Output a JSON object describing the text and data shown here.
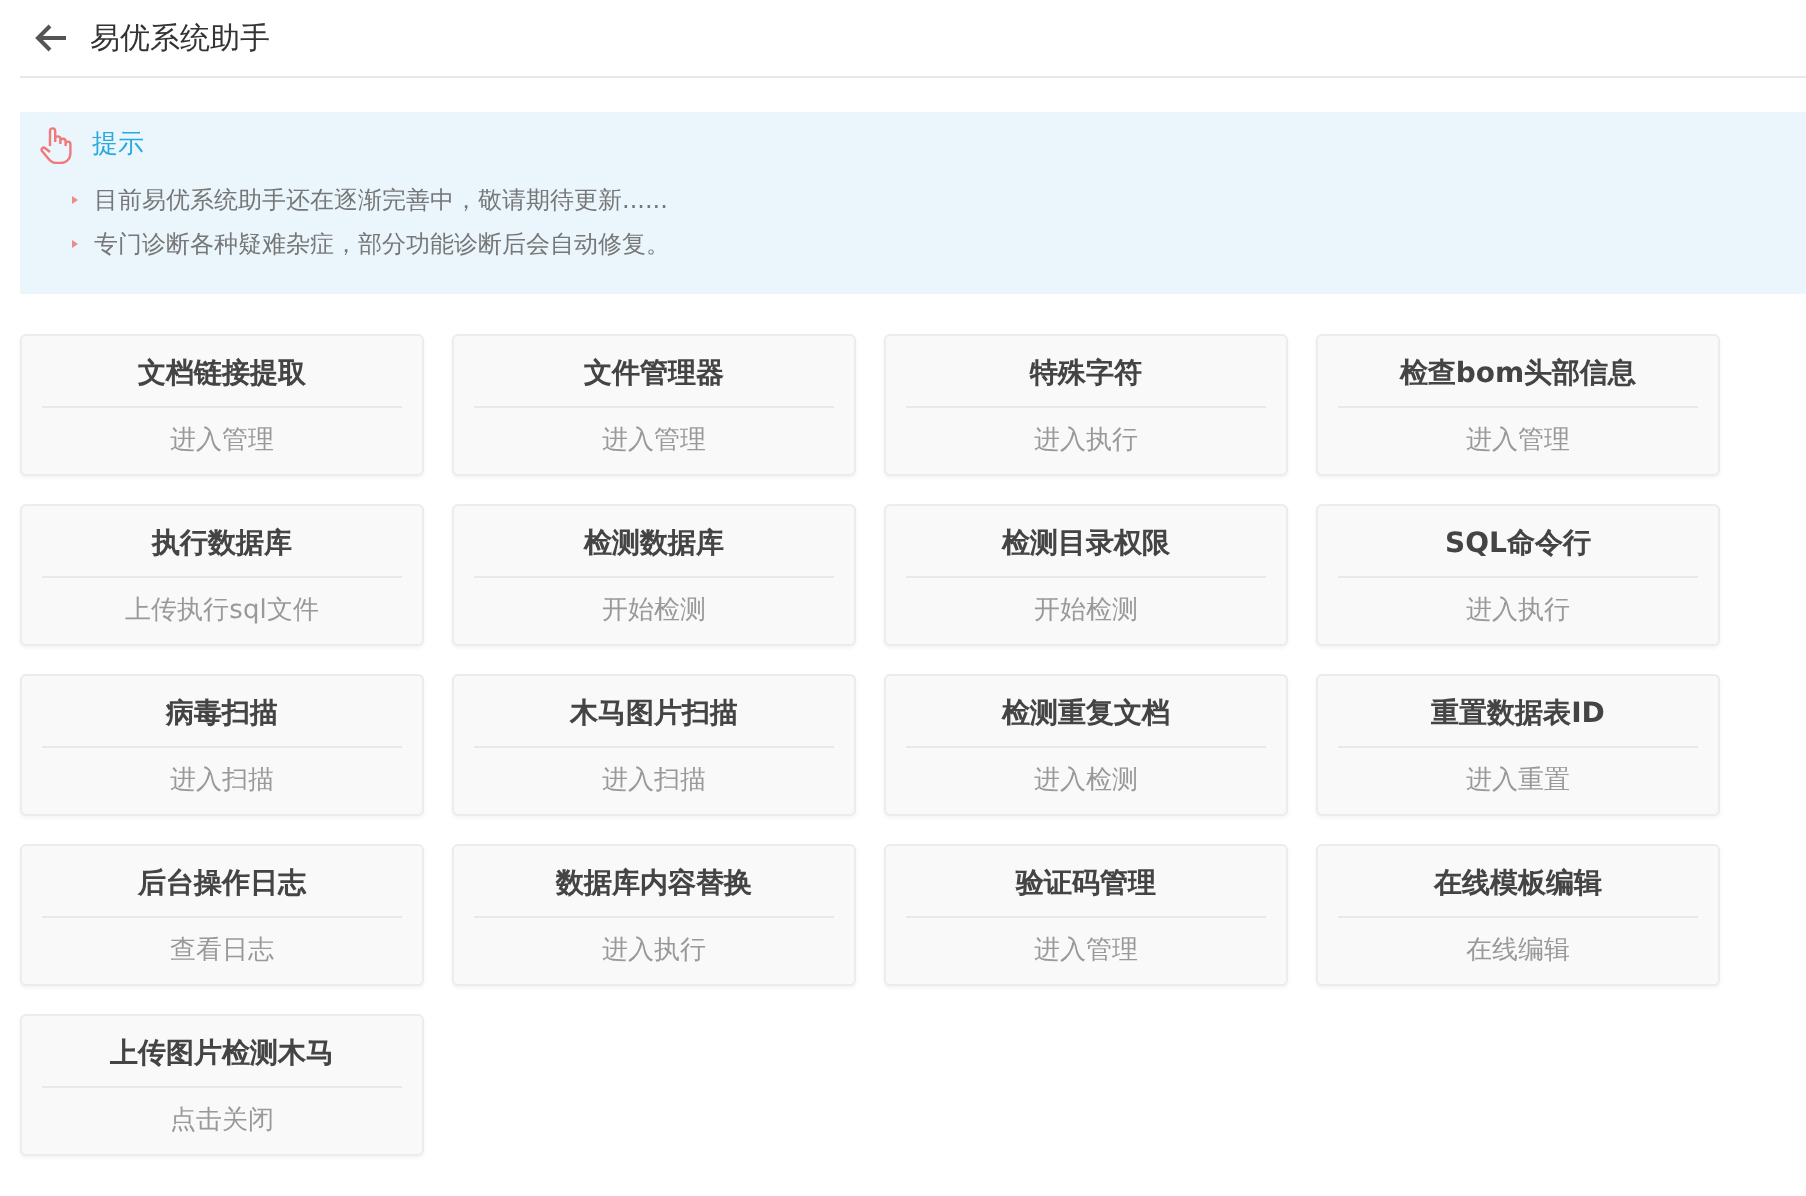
{
  "header": {
    "title": "易优系统助手"
  },
  "tip": {
    "title": "提示",
    "lines": [
      "目前易优系统助手还在逐渐完善中，敬请期待更新......",
      "专门诊断各种疑难杂症，部分功能诊断后会自动修复。"
    ]
  },
  "tools": [
    {
      "title": "文档链接提取",
      "action": "进入管理"
    },
    {
      "title": "文件管理器",
      "action": "进入管理"
    },
    {
      "title": "特殊字符",
      "action": "进入执行"
    },
    {
      "title": "检查bom头部信息",
      "action": "进入管理"
    },
    {
      "title": "执行数据库",
      "action": "上传执行sql文件"
    },
    {
      "title": "检测数据库",
      "action": "开始检测"
    },
    {
      "title": "检测目录权限",
      "action": "开始检测"
    },
    {
      "title": "SQL命令行",
      "action": "进入执行"
    },
    {
      "title": "病毒扫描",
      "action": "进入扫描"
    },
    {
      "title": "木马图片扫描",
      "action": "进入扫描"
    },
    {
      "title": "检测重复文档",
      "action": "进入检测"
    },
    {
      "title": "重置数据表ID",
      "action": "进入重置"
    },
    {
      "title": "后台操作日志",
      "action": "查看日志"
    },
    {
      "title": "数据库内容替换",
      "action": "进入执行"
    },
    {
      "title": "验证码管理",
      "action": "进入管理"
    },
    {
      "title": "在线模板编辑",
      "action": "在线编辑"
    },
    {
      "title": "上传图片检测木马",
      "action": "点击关闭"
    }
  ]
}
